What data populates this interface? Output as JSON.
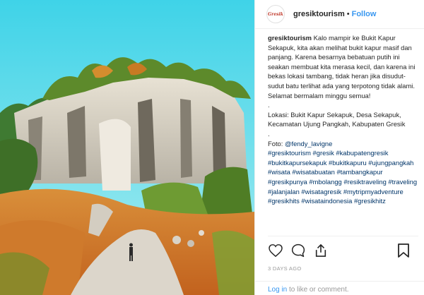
{
  "post": {
    "photo_alt": "Bukit Kapur Sekapuk limestone cliffs",
    "account": {
      "username": "gresiktourism",
      "logo_text": "Gresik",
      "separator": "•",
      "follow_label": "Follow"
    },
    "caption": {
      "username": "gresiktourism",
      "text": "Kalo mampir ke Bukit Kapur Sekapuk, kita akan melihat bukit kapur masif dan panjang. Karena besarnya bebatuan putih ini seakan membuat kita merasa kecil, dan karena ini bekas lokasi tambang, tidak heran jika disudut-sudut batu terlihat ada yang terpotong tidak alami. Selamat bermalam minggu semua!",
      "dot": ".",
      "location": "Lokasi: Bukit Kapur Sekapuk, Desa Sekapuk, Kecamatan Ujung Pangkah, Kabupaten Gresik",
      "dot2": ".",
      "credit_prefix": "Foto: ",
      "credit_handle": "@fendy_lavigne",
      "hashtags": "#gresiktourism #gresik #kabupatengresik #bukitkapursekapuk #bukitkapuru #ujungpangkah #wisata #wisatabuatan #tambangkapur #gresikpunya #mbolangg #resiktraveling #traveling #jalanjalan #wisatagresik #mytripmyadventure #gresikhits #wisataindonesia #gresikhitz"
    },
    "actions": {
      "like_icon": "heart-icon",
      "comment_icon": "comment-icon",
      "share_icon": "share-icon",
      "save_icon": "bookmark-icon"
    },
    "time_ago": "3 DAYS AGO",
    "login": {
      "link_text": "Log in",
      "suffix": " to like or comment."
    }
  }
}
